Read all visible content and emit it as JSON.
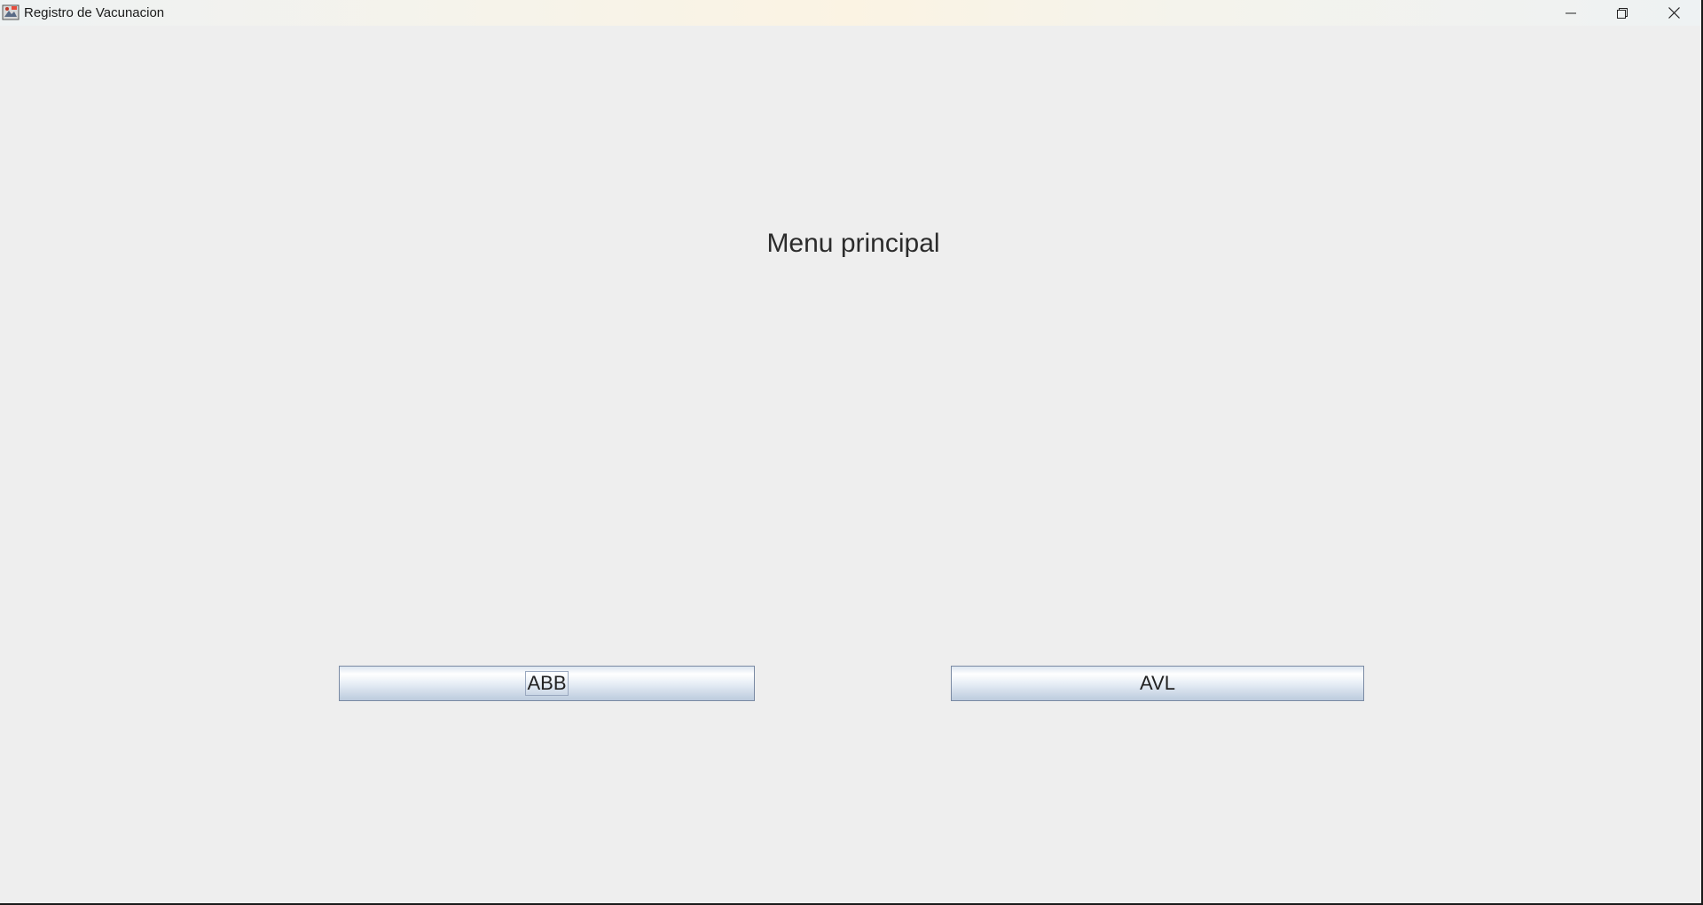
{
  "window": {
    "title": "Registro de Vacunacion",
    "controls": {
      "minimize": "minimize-icon",
      "maximize": "restore-icon",
      "close": "close-icon"
    }
  },
  "main": {
    "heading": "Menu principal",
    "buttons": [
      {
        "label": "ABB",
        "focused": true
      },
      {
        "label": "AVL",
        "focused": false
      }
    ]
  }
}
